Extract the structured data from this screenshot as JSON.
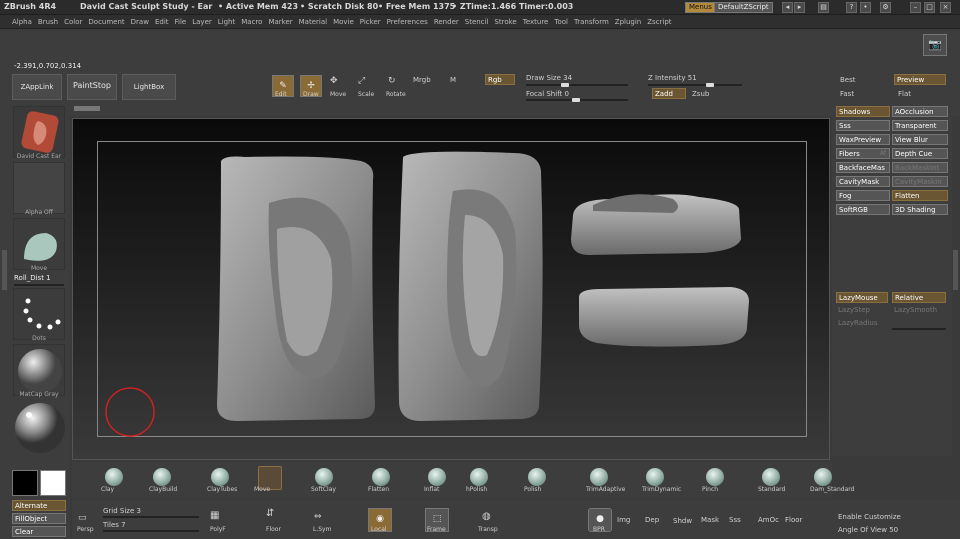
{
  "titlebar": {
    "title": "ZBrush 4R4",
    "doc": "David Cast Sculpt Study - Ear",
    "active_mem": "• Active Mem 423",
    "scratch": "• Scratch Disk 80",
    "free_mem": "• Free Mem 1375",
    "ztime": "• ZTime:1.466 Timer:0.003",
    "menus_btn": "Menus",
    "script_btn": "DefaultZScript"
  },
  "menubar": [
    "Alpha",
    "Brush",
    "Color",
    "Document",
    "Draw",
    "Edit",
    "File",
    "Layer",
    "Light",
    "Macro",
    "Marker",
    "Material",
    "Movie",
    "Picker",
    "Preferences",
    "Render",
    "Stencil",
    "Stroke",
    "Texture",
    "Tool",
    "Transform",
    "Zplugin",
    "Zscript"
  ],
  "coords": "-2.391,0.702,0.314",
  "toolbar": {
    "zapplink": "ZAppLink",
    "paintstop": "PaintStop",
    "lightbox": "LightBox",
    "edit": "Edit",
    "draw": "Draw",
    "move": "Move",
    "scale": "Scale",
    "rotate": "Rotate",
    "mrgb": "Mrgb",
    "m": "M",
    "rgb": "Rgb",
    "draw_size_label": "Draw Size",
    "draw_size": "34",
    "focal_label": "Focal Shift",
    "focal": "0",
    "zint_label": "Z Intensity",
    "zint": "51",
    "zadd": "Zadd",
    "zsub": "Zsub"
  },
  "left": {
    "tool_label": "David Cast Ear",
    "alpha_label": "Alpha Off",
    "move_label": "Move",
    "roll_label": "Roll_Dist 1",
    "dots_label": "Dots",
    "mat_label": "MatCap Gray",
    "alternate": "Alternate",
    "fillobject": "FillObject",
    "clear": "Clear"
  },
  "right": {
    "best": "Best",
    "preview": "Preview",
    "fast": "Fast",
    "flat": "Flat",
    "rows": [
      [
        "Shadows",
        "AOcclusion"
      ],
      [
        "Sss",
        "Transparent"
      ],
      [
        "WaxPreview",
        "View Blur"
      ],
      [
        "Fibers",
        "Depth Cue"
      ],
      [
        "BackfaceMas",
        "BackMaskInt"
      ],
      [
        "CavityMask",
        "CavityMaskIn"
      ],
      [
        "Fog",
        "Flatten"
      ],
      [
        "SoftRGB",
        "3D Shading"
      ]
    ],
    "fibers_af": "Af",
    "lazymouse": "LazyMouse",
    "relative": "Relative",
    "lazystep": "LazyStep",
    "lazysmooth": "LazySmooth",
    "lazyradius": "LazyRadius",
    "enable_customize": "Enable Customize",
    "angle_label": "Angle Of View",
    "angle": "50"
  },
  "brushes": [
    "Clay",
    "ClayBuild",
    "ClayTubes",
    "Move",
    "SoftClay",
    "Flatten",
    "Inflat",
    "hPolish",
    "Polish",
    "TrimAdaptive",
    "TrimDynamic",
    "Pinch",
    "Standard",
    "Dam_Standard"
  ],
  "bottom": {
    "persp": "Persp",
    "grid_label": "Grid Size",
    "grid": "3",
    "tiles_label": "Tiles",
    "tiles": "7",
    "polyf": "PolyF",
    "floor": "Floor",
    "lsym": "L.Sym",
    "local": "Local",
    "frame": "Frame",
    "transp": "Transp",
    "bpr": "BPR",
    "img": "Img",
    "dep": "Dep",
    "shdw": "Shdw",
    "mask": "Mask",
    "sss": "Sss",
    "amoc": "AmOc",
    "floor2": "Floor"
  },
  "colors": {
    "accent": "#b38a3c",
    "clay": "#8a8a8a",
    "bg": "#3a3a3a"
  }
}
